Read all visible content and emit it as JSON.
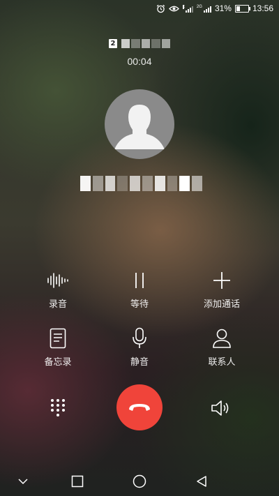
{
  "status_bar": {
    "battery_percent": "31%",
    "battery_level": 0.31,
    "network_tag": "2G",
    "time": "13:56",
    "icons": [
      "alarm-icon",
      "eye-comfort-icon",
      "signal-1-icon",
      "signal-2-icon",
      "battery-icon"
    ]
  },
  "call": {
    "sim_slot": "2",
    "timer": "00:04"
  },
  "actions": {
    "record": "录音",
    "hold": "等待",
    "add_call": "添加通话",
    "memo": "备忘录",
    "mute": "静音",
    "contacts": "联系人"
  },
  "controls": {
    "dialpad_icon": "dialpad-icon",
    "hangup_icon": "hangup-icon",
    "speaker_icon": "speaker-icon"
  },
  "navbar": {
    "icons": [
      "collapse-icon",
      "recents-icon",
      "home-icon",
      "back-icon"
    ]
  },
  "colors": {
    "hangup": "#f0443a",
    "text": "#ffffff",
    "avatar_bg": "#8a8a8a"
  }
}
